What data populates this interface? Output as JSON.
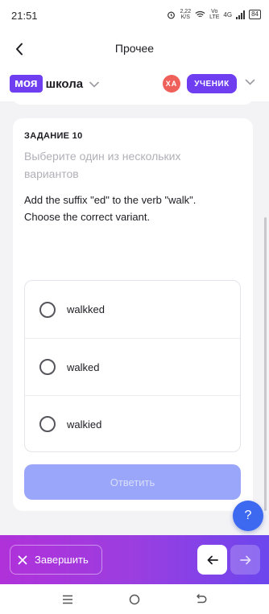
{
  "status_bar": {
    "time": "21:51",
    "speed_value": "2,22",
    "speed_unit": "K/S",
    "network_top": "Vo",
    "network_bottom": "LTE",
    "signal": "4G",
    "battery": "84"
  },
  "header": {
    "title": "Прочее",
    "back_icon": "arrow-left-icon"
  },
  "brand": {
    "logo_part1": "моя",
    "logo_part2": "школа",
    "avatar_initials": "ХА",
    "role_badge": "УЧЕНИК",
    "accent_color": "#6f3ef0",
    "avatar_color": "#f0605a"
  },
  "task": {
    "label": "ЗАДАНИЕ 10",
    "hint": "Выберите один из нескольких вариантов",
    "question": "Add the suffix \"ed\" to the verb \"walk\". Choose the correct variant.",
    "options": [
      {
        "label": "walkked",
        "selected": false
      },
      {
        "label": "walked",
        "selected": false
      },
      {
        "label": "walkied",
        "selected": false
      }
    ],
    "submit_label": "Ответить",
    "submit_color": "#9aa6fa"
  },
  "help": {
    "label": "?",
    "color": "#3d68f0"
  },
  "bottom_bar": {
    "finish_label": "Завершить",
    "prev_icon": "arrow-left-icon",
    "next_icon": "arrow-right-icon"
  },
  "system_nav": {
    "items": [
      "menu-icon",
      "home-icon",
      "back-icon"
    ]
  }
}
